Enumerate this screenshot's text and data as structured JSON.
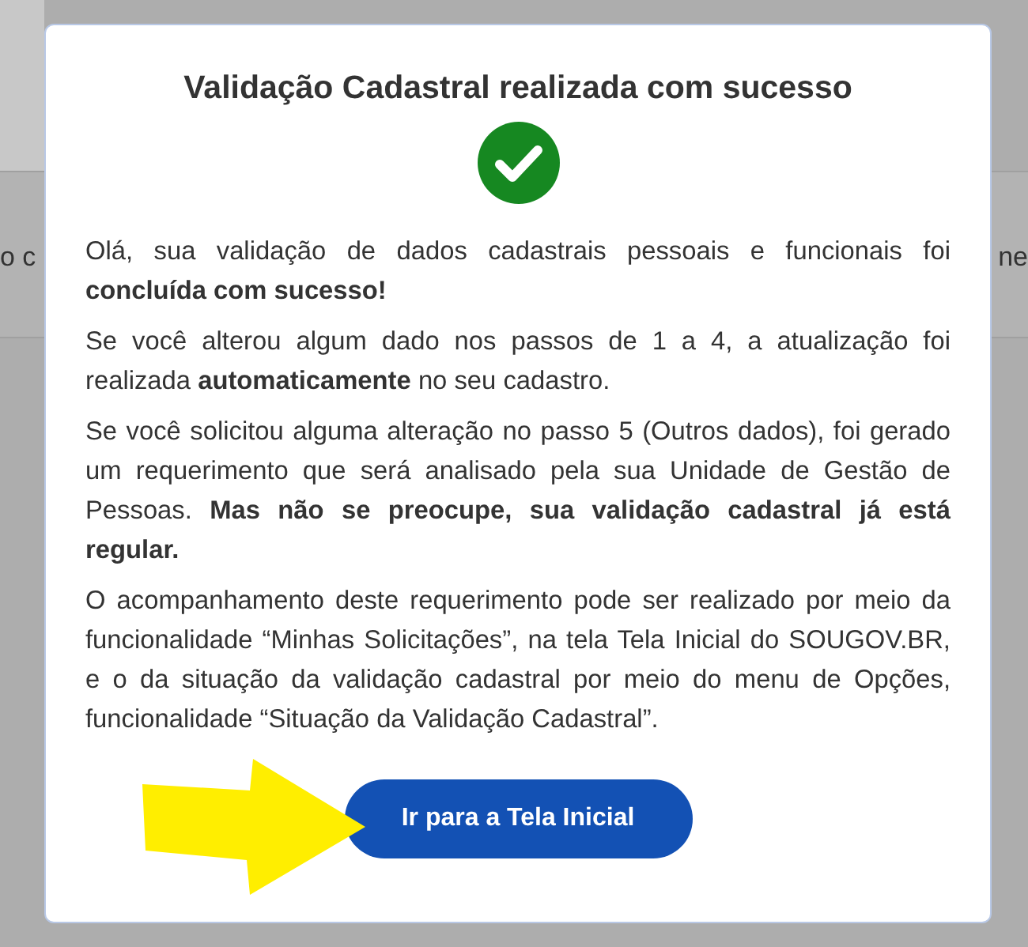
{
  "background": {
    "left_fragment": "o c",
    "right_fragment": "ne"
  },
  "dialog": {
    "title": "Validação Cadastral realizada com sucesso",
    "paragraphs": [
      "Olá, sua validação de dados cadastrais pessoais e funcionais foi **concluída com sucesso!**",
      "Se você alterou algum dado nos passos de 1 a 4, a atualização foi realizada **automaticamente** no seu cadastro.",
      "Se você solicitou alguma alteração no passo 5 (Outros dados), foi gerado um requerimento que será analisado pela sua Unidade de Gestão de Pessoas. **Mas não se preocupe, sua validação cadastral já está regular.**",
      "O acompanhamento deste requerimento pode ser realizado por meio da funcionalidade “Minhas Solicitações”, na tela Tela Inicial do SOUGOV.BR, e o da situação da validação cadastral por meio do menu de Opções, funcionalidade “Situação da Validação Cadastral”."
    ],
    "button": "Ir para a Tela Inicial"
  }
}
